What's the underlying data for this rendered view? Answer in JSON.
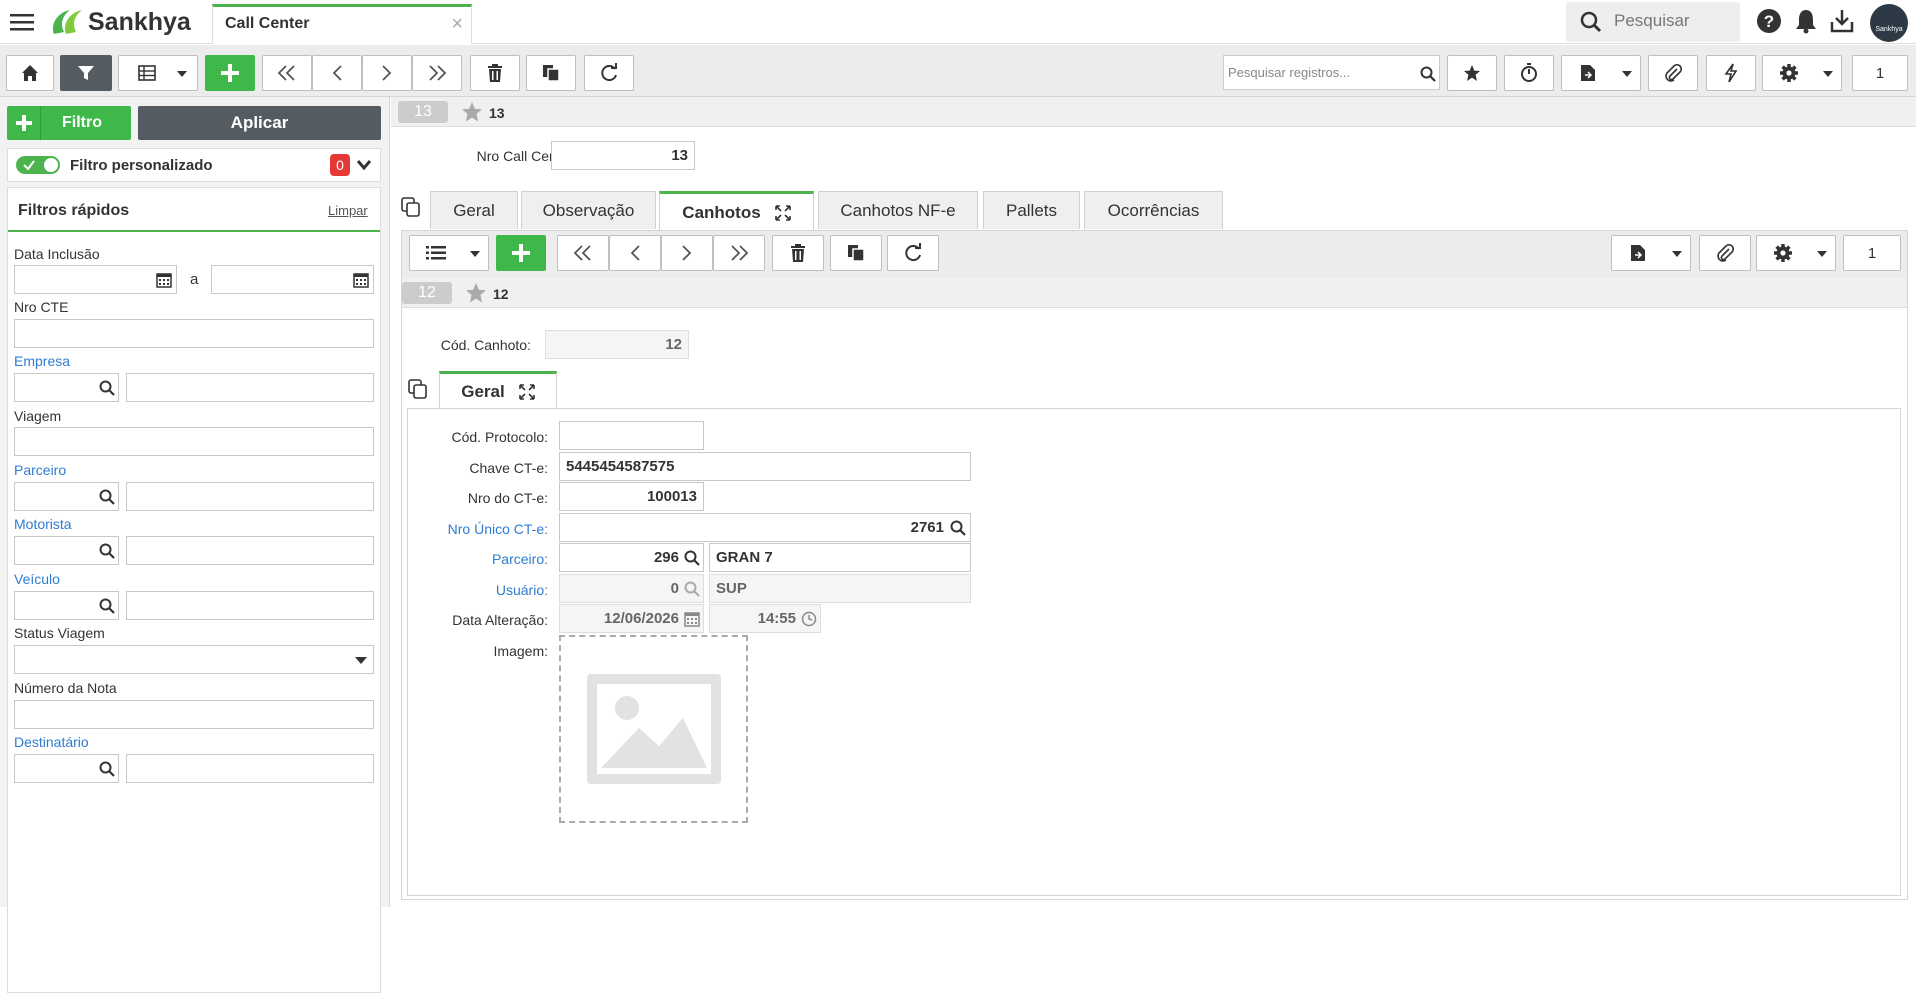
{
  "header": {
    "app_name": "Sankhya",
    "tab_title": "Call Center",
    "search_placeholder": "Pesquisar",
    "avatar_text": "Sankhya"
  },
  "toolbar": {
    "search_records_placeholder": "Pesquisar registros...",
    "page_number": "1"
  },
  "filters": {
    "add_filter_label": "Filtro",
    "apply_label": "Aplicar",
    "custom_filter_label": "Filtro personalizado",
    "custom_filter_count": "0",
    "quick_filters_title": "Filtros rápidos",
    "clear_label": "Limpar",
    "date_label": "Data Inclusão",
    "date_separator": "a",
    "nro_cte_label": "Nro CTE",
    "empresa_label": "Empresa",
    "viagem_label": "Viagem",
    "parceiro_label": "Parceiro",
    "motorista_label": "Motorista",
    "veiculo_label": "Veículo",
    "status_viagem_label": "Status Viagem",
    "numero_nota_label": "Número da Nota",
    "destinatario_label": "Destinatário"
  },
  "record": {
    "badge": "13",
    "star_number": "13",
    "nro_call_center_label": "Nro Call Center:",
    "nro_call_center_value": "13"
  },
  "tabs": [
    {
      "label": "Geral"
    },
    {
      "label": "Observação"
    },
    {
      "label": "Canhotos"
    },
    {
      "label": "Canhotos NF-e"
    },
    {
      "label": "Pallets"
    },
    {
      "label": "Ocorrências"
    }
  ],
  "detail_toolbar": {
    "page_number": "1"
  },
  "detail": {
    "badge": "12",
    "star_number": "12",
    "cod_canhoto_label": "Cód. Canhoto:",
    "cod_canhoto_value": "12",
    "subtab_label": "Geral",
    "cod_protocolo_label": "Cód. Protocolo:",
    "cod_protocolo_value": "",
    "chave_cte_label": "Chave CT-e:",
    "chave_cte_value": "5445454587575",
    "nro_cte_label": "Nro do CT-e:",
    "nro_cte_value": "100013",
    "nro_unico_label": "Nro Único CT-e:",
    "nro_unico_value": "2761",
    "parceiro_label": "Parceiro:",
    "parceiro_code": "296",
    "parceiro_name": "GRAN 7",
    "usuario_label": "Usuário:",
    "usuario_code": "0",
    "usuario_name": "SUP",
    "data_alteracao_label": "Data Alteração:",
    "data_alteracao_date": "12/06/2026",
    "data_alteracao_time": "14:55",
    "imagem_label": "Imagem:"
  },
  "colors": {
    "accent_green": "#4cb34f",
    "link_blue": "#2f7dd1",
    "badge_red": "#e53935",
    "dark_button": "#555c61"
  }
}
